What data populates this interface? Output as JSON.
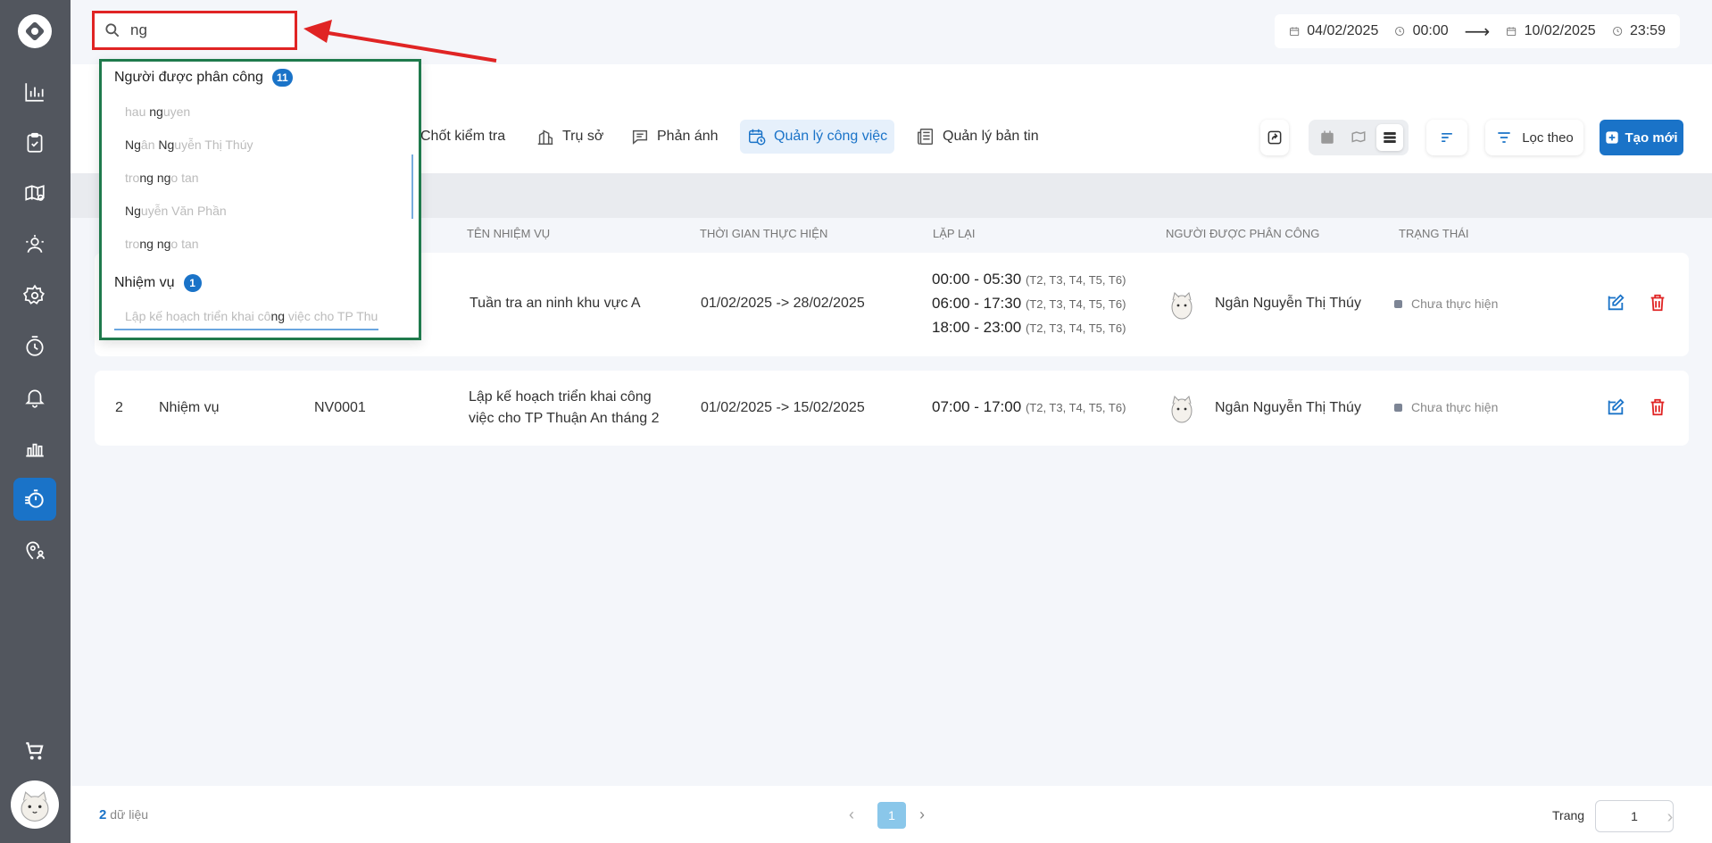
{
  "search": {
    "value": "ng",
    "placeholder": ""
  },
  "date_range": {
    "start_date": "04/02/2025",
    "start_time": "00:00",
    "arrow": "⟶",
    "end_date": "10/02/2025",
    "end_time": "23:59"
  },
  "dropdown": {
    "assignees": {
      "label": "Người được phân công",
      "count": "11",
      "items": [
        {
          "pre": "hau ",
          "hl": "ng",
          "post": "uyen"
        },
        {
          "pre": "",
          "hl": "Ng",
          "post": "ân ",
          "hl2": "Ng",
          "post2": "uyễn Thị Thúy"
        },
        {
          "pre": "tro",
          "hl": "ng",
          "post": " ",
          "hl2": "ng",
          "post2": "o tan"
        },
        {
          "pre": "",
          "hl": "Ng",
          "post": "uyễn Văn Phần"
        },
        {
          "pre": "tro",
          "hl": "ng",
          "post": " ",
          "hl2": "ng",
          "post2": "o tan"
        }
      ]
    },
    "tasks": {
      "label": "Nhiệm vụ",
      "count": "1",
      "item": {
        "pre": "Lập kế hoạch triển khai cô",
        "hl": "ng",
        "post": " việc cho TP Thuận An"
      }
    }
  },
  "tabs": [
    {
      "label": "Chốt kiểm tra",
      "icon": "checkpoint-icon"
    },
    {
      "label": "Trụ sở",
      "icon": "building-icon"
    },
    {
      "label": "Phản ánh",
      "icon": "chat-icon"
    },
    {
      "label": "Quản lý công việc",
      "icon": "calendar-clock-icon",
      "active": true
    },
    {
      "label": "Quản lý bản tin",
      "icon": "news-icon"
    }
  ],
  "toolbar": {
    "filter_label": "Lọc theo",
    "create_label": "Tạo mới"
  },
  "table": {
    "headers": [
      "Tên nhiệm vụ",
      "Thời gian thực hiện",
      "Lặp lại",
      "Người được phân công",
      "Trạng thái"
    ],
    "rows": [
      {
        "index": "",
        "type": "",
        "code": "",
        "name": "Tuần tra an ninh khu vực A",
        "period": "01/02/2025 -> 28/02/2025",
        "schedules": [
          {
            "time": "00:00 - 05:30",
            "days": "(T2, T3, T4, T5, T6)"
          },
          {
            "time": "06:00 - 17:30",
            "days": "(T2, T3, T4, T5, T6)"
          },
          {
            "time": "18:00 - 23:00",
            "days": "(T2, T3, T4, T5, T6)"
          }
        ],
        "assignee": "Ngân Nguyễn Thị Thúy",
        "status": "Chưa thực hiện"
      },
      {
        "index": "2",
        "type": "Nhiệm vụ",
        "code": "NV0001",
        "name_line1": "Lập kế hoạch triển khai công",
        "name_line2": "việc cho TP Thuận An tháng 2",
        "period": "01/02/2025 -> 15/02/2025",
        "schedules": [
          {
            "time": "07:00 - 17:00",
            "days": "(T2, T3, T4, T5, T6)"
          }
        ],
        "assignee": "Ngân Nguyễn Thị Thúy",
        "status": "Chưa thực hiện"
      }
    ]
  },
  "footer": {
    "total_count": "2",
    "total_label": " dữ liệu",
    "current_page": "1",
    "page_label": "Trang",
    "page_input": "1"
  },
  "colors": {
    "accent": "#1a73c8",
    "sidebar": "#52565e",
    "highlight_box": "#e02424",
    "dropdown_border": "#1f7a4c"
  }
}
